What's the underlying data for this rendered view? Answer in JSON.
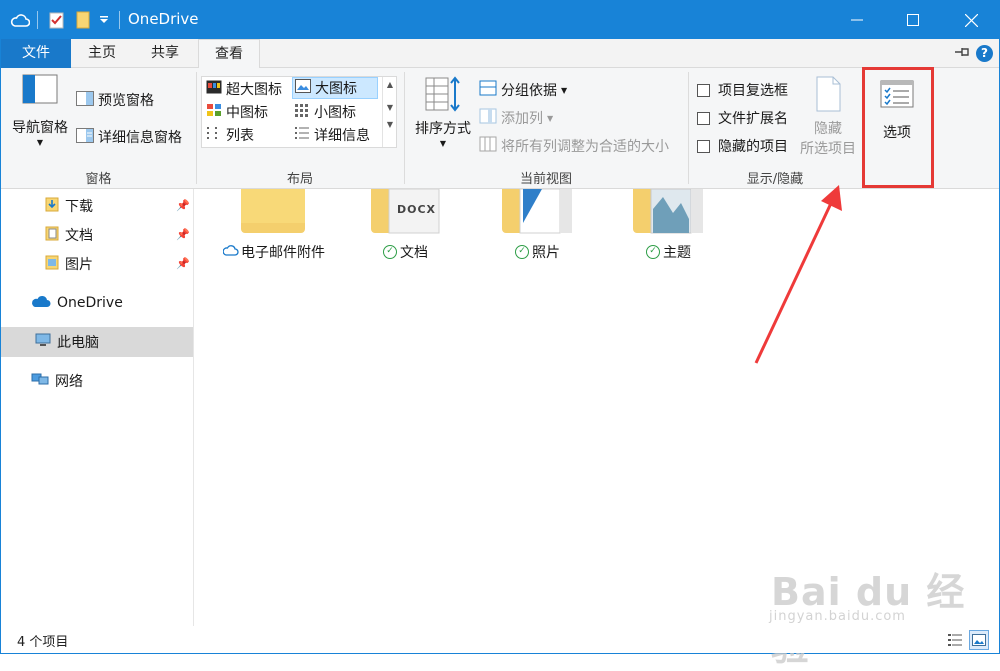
{
  "window": {
    "title": "OneDrive"
  },
  "tabs": [
    {
      "label": "文件"
    },
    {
      "label": "主页"
    },
    {
      "label": "共享"
    },
    {
      "label": "查看"
    }
  ],
  "ribbon": {
    "panes": {
      "nav_pane": "导航窗格",
      "preview_pane": "预览窗格",
      "details_pane": "详细信息窗格",
      "group_label": "窗格"
    },
    "layout": {
      "items": [
        "超大图标",
        "大图标",
        "中图标",
        "小图标",
        "列表",
        "详细信息"
      ],
      "selected": "大图标",
      "group_label": "布局"
    },
    "current_view": {
      "sort_by": "排序方式",
      "group_by": "分组依据",
      "add_column": "添加列",
      "fit_columns": "将所有列调整为合适的大小",
      "group_label": "当前视图"
    },
    "show_hide": {
      "item_checkboxes": "项目复选框",
      "file_extensions": "文件扩展名",
      "hidden_items": "隐藏的项目",
      "hide_selected_line1": "隐藏",
      "hide_selected_line2": "所选项目",
      "group_label": "显示/隐藏"
    },
    "options": {
      "label": "选项"
    }
  },
  "nav": {
    "quick_access": [
      {
        "label": "下载"
      },
      {
        "label": "文档"
      },
      {
        "label": "图片"
      }
    ],
    "onedrive": "OneDrive",
    "this_pc": "此电脑",
    "network": "网络"
  },
  "content": {
    "items": [
      {
        "name": "电子邮件附件",
        "status": "cloud"
      },
      {
        "name": "文档",
        "status": "synced",
        "badge": "DOCX"
      },
      {
        "name": "照片",
        "status": "synced"
      },
      {
        "name": "主题",
        "status": "synced"
      }
    ]
  },
  "status": {
    "count": "4 个项目"
  },
  "watermark": {
    "text": "Bai du 经验",
    "url": "jingyan.baidu.com"
  },
  "colors": {
    "accent": "#1883d7",
    "highlight": "#e53935",
    "synced": "#2e9e47"
  }
}
